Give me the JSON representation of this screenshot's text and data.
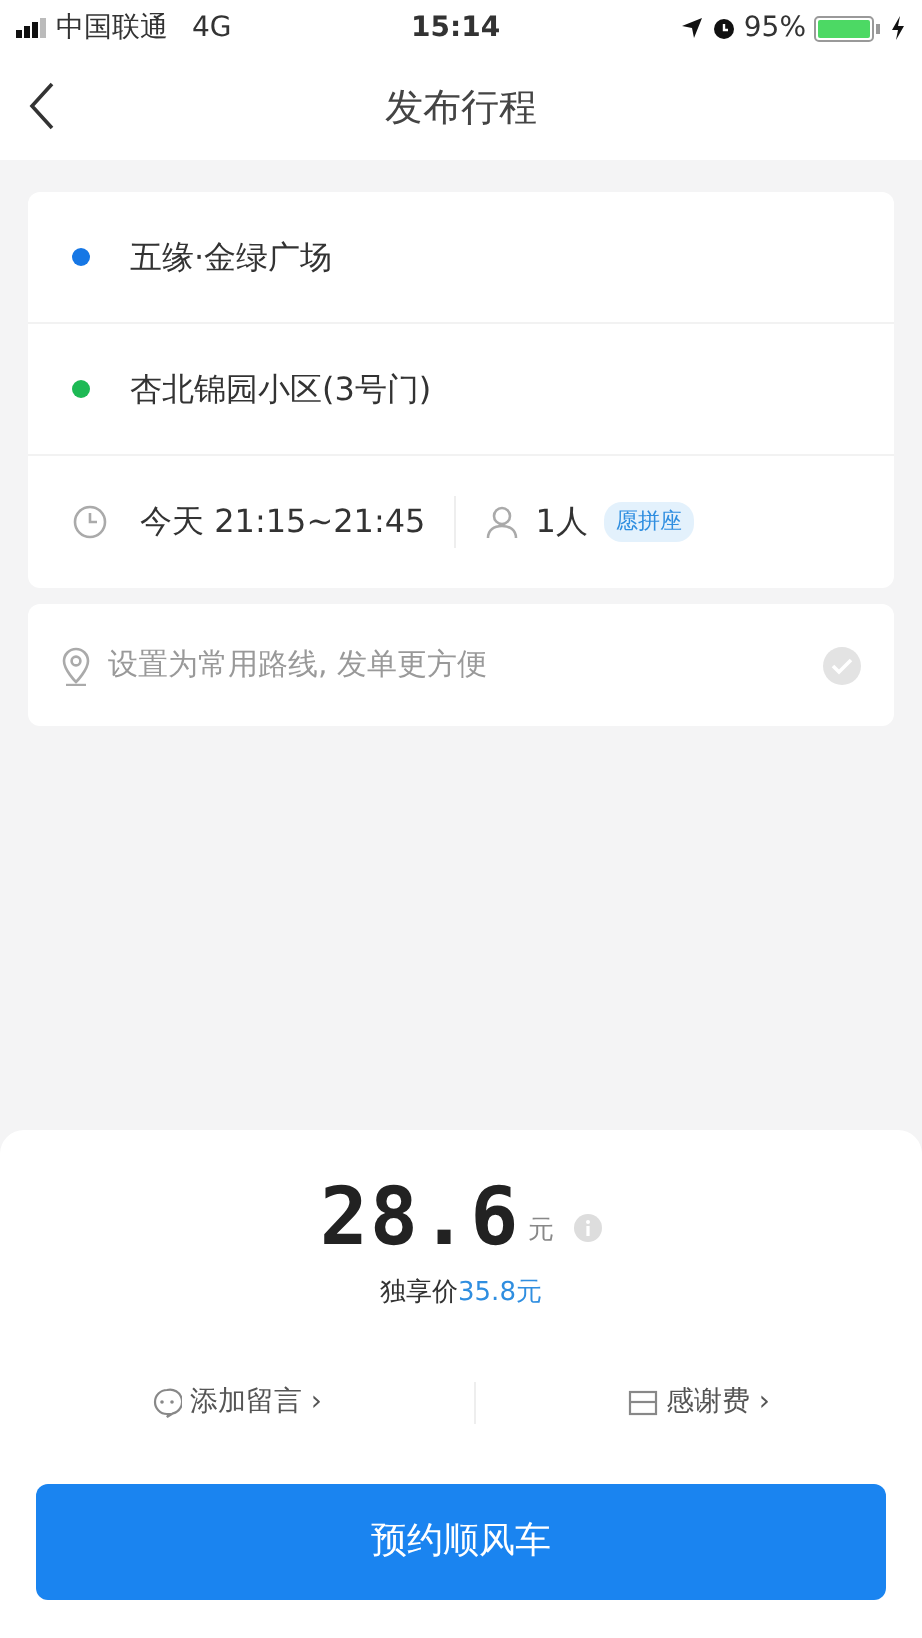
{
  "status_bar": {
    "carrier": "中国联通",
    "network": "4G",
    "time": "15:14",
    "battery": "95%"
  },
  "header": {
    "title": "发布行程"
  },
  "route": {
    "stops": [
      {
        "name": "五缘·金绿广场",
        "color": "#1677e5"
      },
      {
        "name": "杏北锦园小区(3号门)",
        "color": "#1db954"
      }
    ],
    "time": "今天 21:15~21:45",
    "passengers": "1人",
    "tag": "愿拼座"
  },
  "favorite": {
    "text": "设置为常用路线, 发单更方便",
    "checked": false
  },
  "price": {
    "amount": "28.6",
    "unit": "元",
    "exclusive_label": "独享价",
    "exclusive_price": "35.8元"
  },
  "options": [
    {
      "kind": "message",
      "label": "添加留言",
      "arrow": "›"
    },
    {
      "kind": "tip",
      "label": "感谢费",
      "arrow": "›"
    }
  ],
  "button": "预约顺风车"
}
